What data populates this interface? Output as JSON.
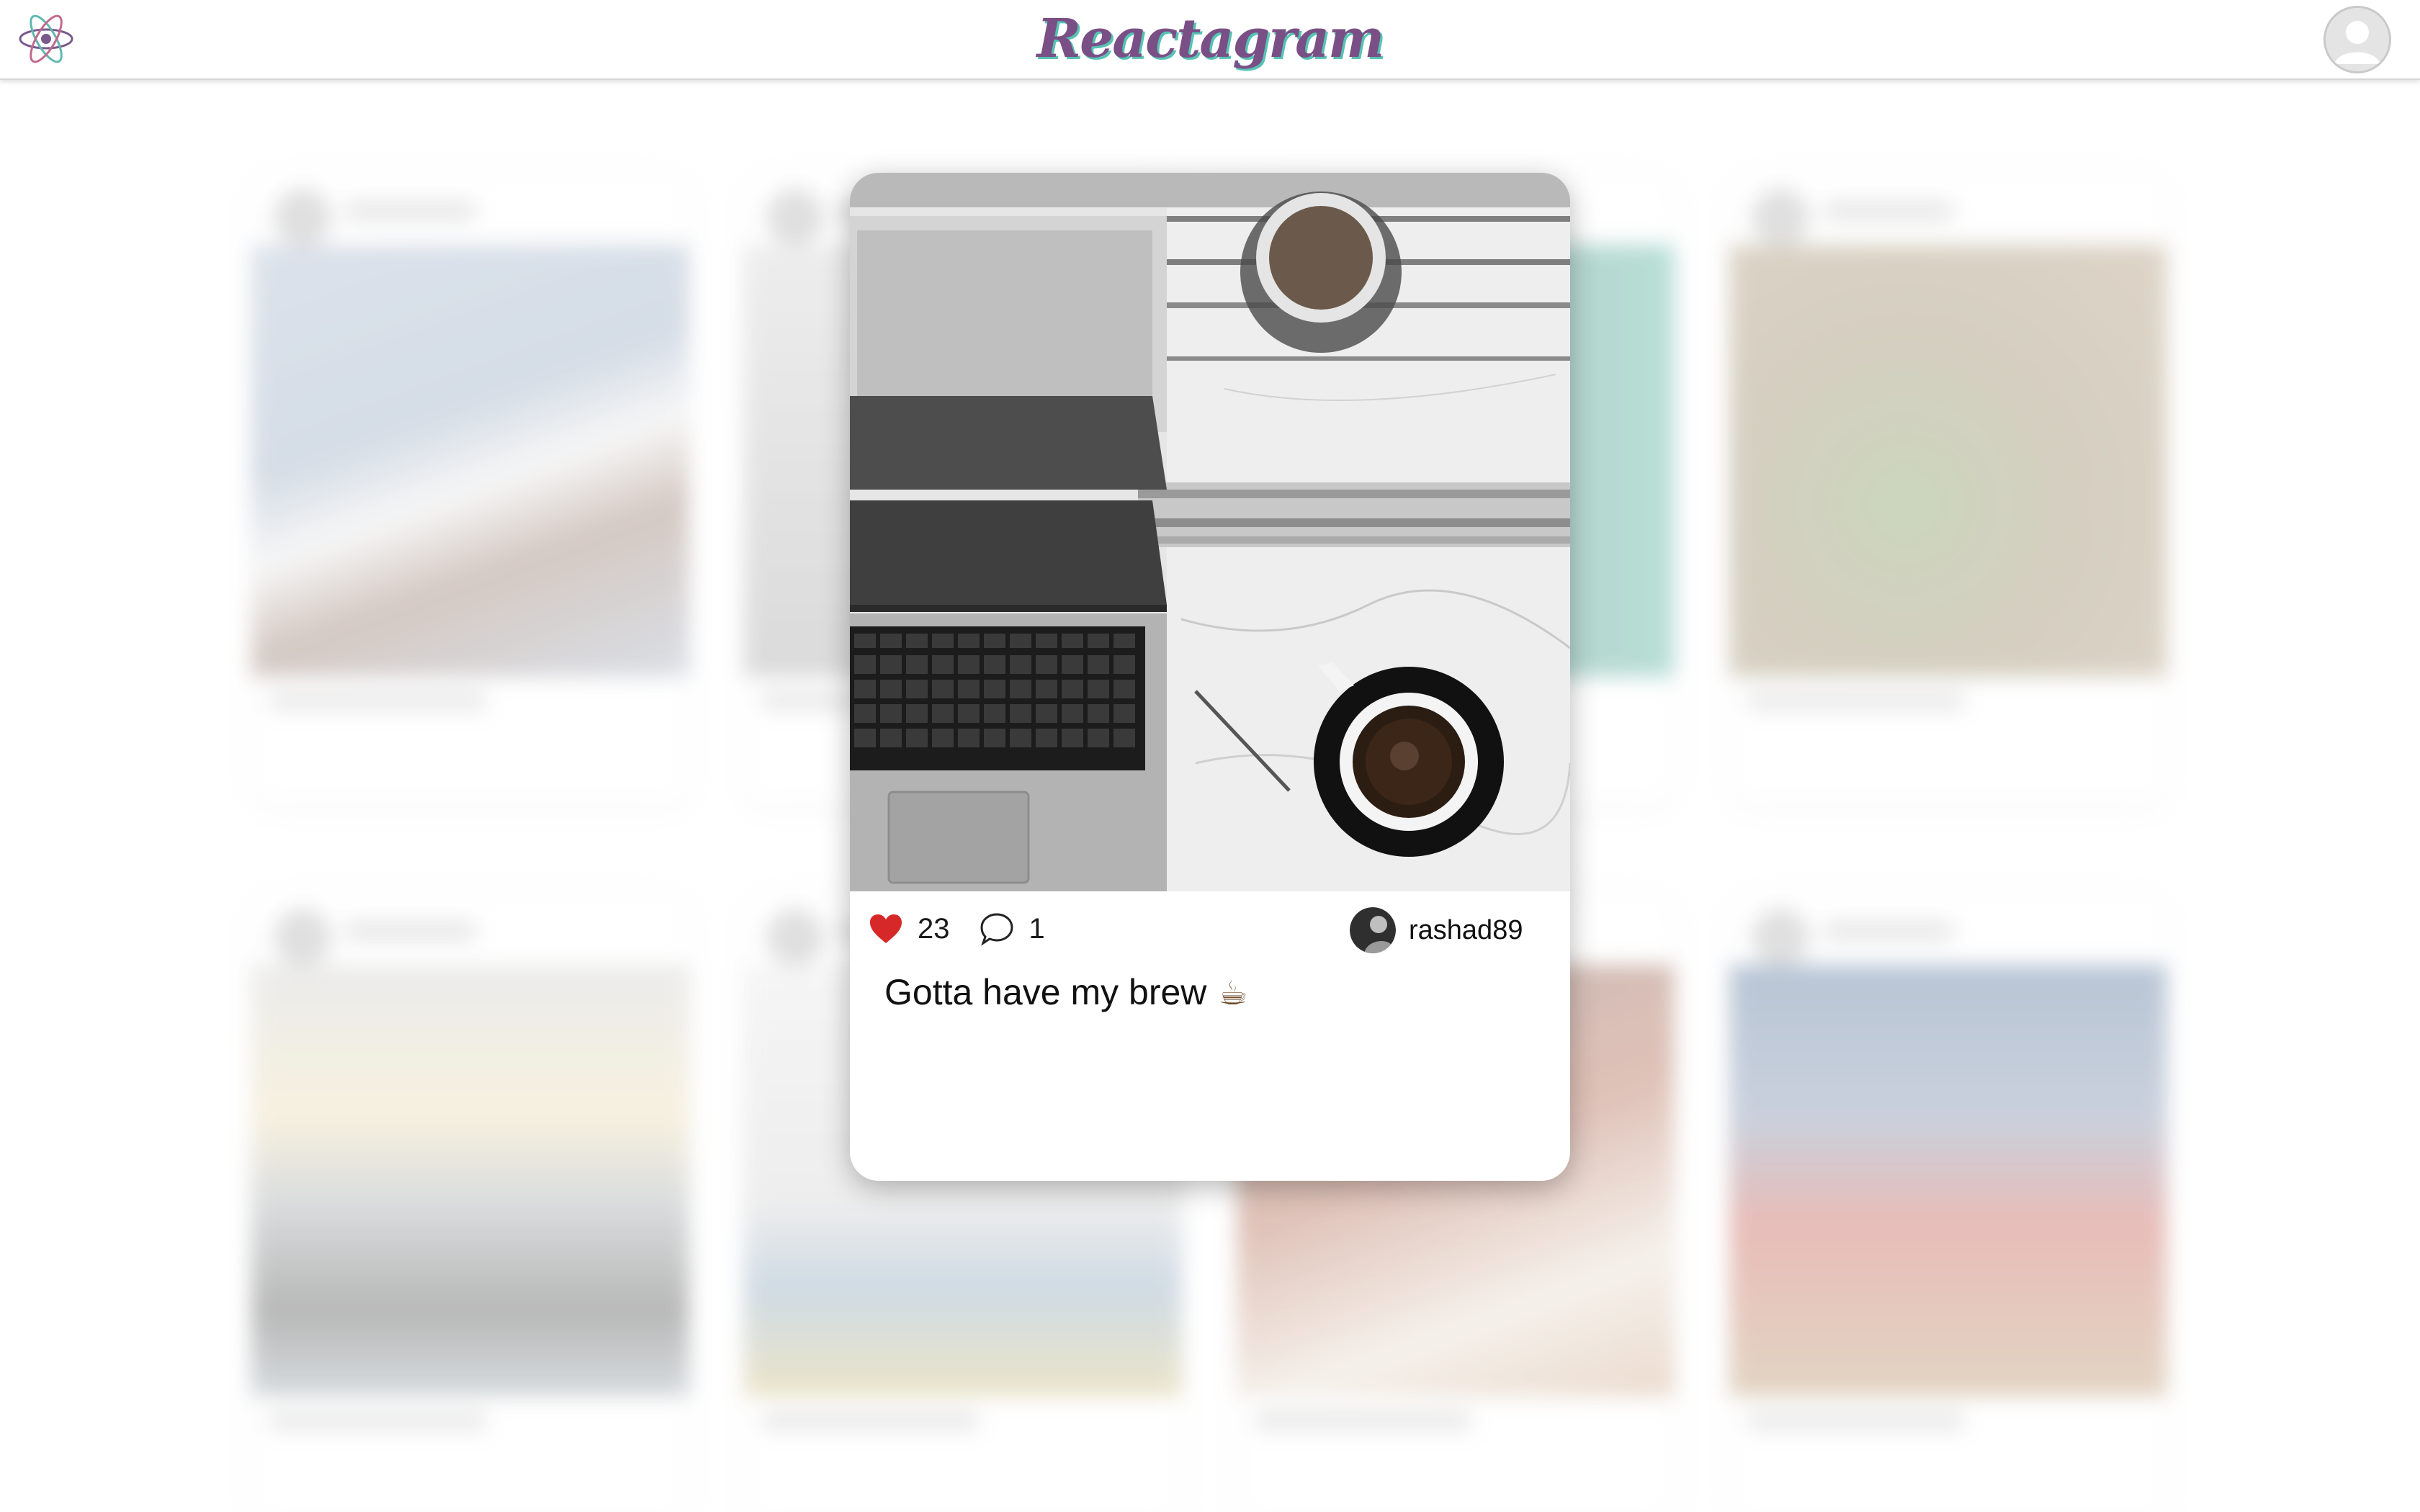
{
  "header": {
    "brand": "Reactagram",
    "logo_icon": "react-atom-icon",
    "profile_icon": "user-avatar-icon"
  },
  "post": {
    "likes": "23",
    "comments": "1",
    "username": "rashad89",
    "caption": "Gotta have my brew",
    "caption_emoji": "☕",
    "liked": true,
    "like_icon": "heart-icon",
    "comment_icon": "comment-bubble-icon",
    "photo_subject": "laptop and black coffee on marble counter"
  },
  "colors": {
    "heart": "#d62828",
    "brand_purple": "#7a4f86",
    "brand_teal": "#56c3b4"
  }
}
